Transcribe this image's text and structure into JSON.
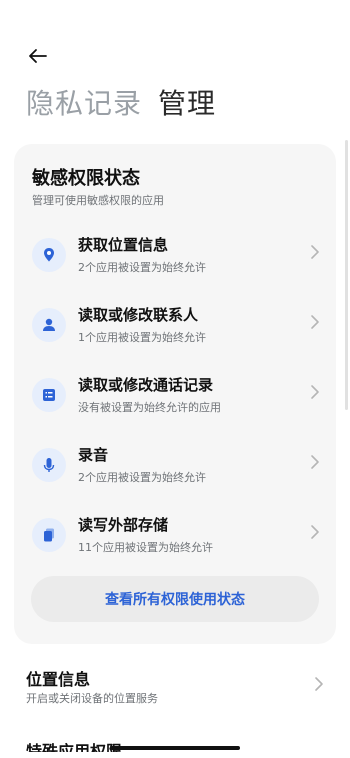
{
  "header": {
    "tab_inactive": "隐私记录",
    "tab_active": "管理"
  },
  "card": {
    "title": "敏感权限状态",
    "subtitle": "管理可使用敏感权限的应用",
    "items": [
      {
        "title": "获取位置信息",
        "desc": "2个应用被设置为始终允许",
        "icon": "location-pin-icon"
      },
      {
        "title": "读取或修改联系人",
        "desc": "1个应用被设置为始终允许",
        "icon": "person-icon"
      },
      {
        "title": "读取或修改通话记录",
        "desc": "没有被设置为始终允许的应用",
        "icon": "call-log-icon"
      },
      {
        "title": "录音",
        "desc": "2个应用被设置为始终允许",
        "icon": "microphone-icon"
      },
      {
        "title": "读写外部存储",
        "desc": "11个应用被设置为始终允许",
        "icon": "storage-icon"
      }
    ],
    "view_all_label": "查看所有权限使用状态"
  },
  "location": {
    "title": "位置信息",
    "desc": "开启或关闭设备的位置服务"
  },
  "next_section": {
    "title": "特殊应用权限"
  },
  "colors": {
    "accent": "#2d63d6",
    "icon_bg": "#e6eefc",
    "card_bg": "#f6f6f6"
  }
}
